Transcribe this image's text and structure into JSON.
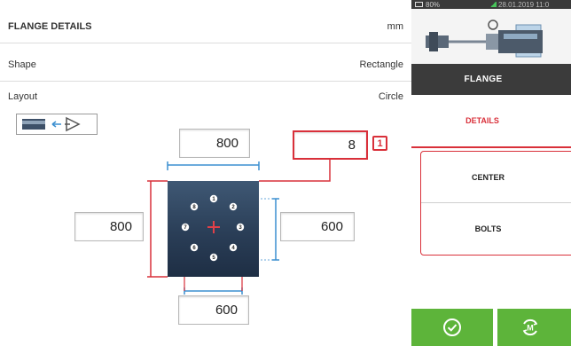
{
  "header": {
    "title": "FLANGE DETAILS",
    "unit": "mm"
  },
  "rows": [
    {
      "label": "Shape",
      "value": "Rectangle"
    },
    {
      "label": "Layout",
      "value": "Circle"
    }
  ],
  "view_icon": "machine-view-direction-icon",
  "dimensions": {
    "top": "800",
    "left": "800",
    "right": "600",
    "bottom": "600",
    "bolt_count": "8",
    "bolt_count_badge": "1"
  },
  "bolt_numbers": [
    "1",
    "2",
    "3",
    "4",
    "5",
    "6",
    "7",
    "8"
  ],
  "status_bar": {
    "battery": "80%",
    "datetime": "28.01.2019 11:0"
  },
  "sidebar": {
    "title": "FLANGE",
    "active_tab": "DETAILS",
    "items": [
      {
        "label": "CENTER"
      },
      {
        "label": "BOLTS"
      }
    ]
  },
  "colors": {
    "accent": "#d9303a",
    "ok_green": "#5db43a",
    "flange": "#2f4560",
    "measure_line": "#3b8fd0"
  },
  "icons": {
    "ok_button": "check-circle-icon",
    "measure_button": "measure-m-icon"
  }
}
